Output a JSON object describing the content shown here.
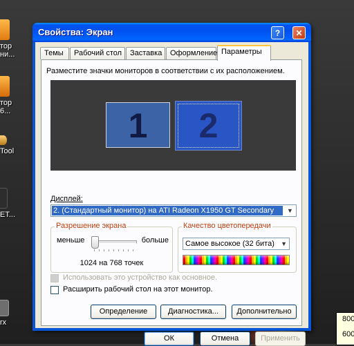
{
  "desktop": {
    "icons": [
      "тор\nни...",
      "тор\n6...",
      "Tool",
      "ET...",
      "rx"
    ]
  },
  "tooltip": {
    "lines": [
      "800",
      "600"
    ]
  },
  "window": {
    "title": "Свойства: Экран",
    "help_button": "?",
    "close_button": "✕",
    "tabs": [
      {
        "label": "Темы",
        "active": false
      },
      {
        "label": "Рабочий стол",
        "active": false
      },
      {
        "label": "Заставка",
        "active": false
      },
      {
        "label": "Оформление",
        "active": false
      },
      {
        "label": "Параметры",
        "active": true
      }
    ],
    "instruction": "Разместите значки мониторов в соответствии с их расположением.",
    "monitors": [
      "1",
      "2"
    ],
    "display_label": "Дисплей:",
    "display_value": "2. (Стандартный монитор) на ATI Radeon X1950 GT Secondary",
    "resolution": {
      "group_title": "Разрешение экрана",
      "less": "меньше",
      "more": "больше",
      "value": "1024 на 768 точек",
      "slider_level": 0
    },
    "color_quality": {
      "group_title": "Качество цветопередачи",
      "value": "Самое высокое (32 бита)"
    },
    "primary_checkbox": {
      "label": "Использовать это устройство как основное.",
      "checked": false,
      "disabled": true
    },
    "extend_checkbox": {
      "label": "Расширить рабочий стол на этот монитор.",
      "checked": false,
      "disabled": false
    },
    "buttons": {
      "identify": "Определение",
      "troubleshoot": "Диагностика...",
      "advanced": "Дополнительно",
      "ok": "ОК",
      "cancel": "Отмена",
      "apply": "Применить"
    }
  }
}
